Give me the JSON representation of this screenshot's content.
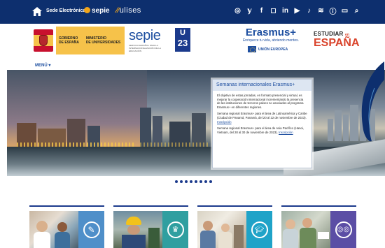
{
  "topbar": {
    "sede_label": "Sede Electrónica",
    "esepie_label": "sepie",
    "ulises_label": "ulises",
    "social_icons": [
      "podcast-icon",
      "twitter-icon",
      "facebook-icon",
      "instagram-icon",
      "linkedin-icon",
      "youtube-icon",
      "tiktok-icon",
      "spotify-icon",
      "info-icon",
      "chat-icon",
      "search-icon"
    ]
  },
  "logos": {
    "gobierno_line1": "GOBIERNO",
    "gobierno_line2": "DE ESPAÑA",
    "ministerio_line1": "MINISTERIO",
    "ministerio_line2": "DE UNIVERSIDADES",
    "sepie_word": "sepie",
    "sepie_sub": "SERVICIO ESPAÑOL PARA LA INTERNACIONALIZACIÓN DE LA EDUCACIÓN",
    "u23_top": "U",
    "u23_bottom": "23",
    "erasmus_word": "Erasmus+",
    "erasmus_tag": "Enriquece tu vida, abriendo mentes.",
    "ue_label": "UNIÓN EUROPEA",
    "estudiar_l1": "ESTUDIAR",
    "estudiar_l1_suffix": "en",
    "estudiar_l2": "ESPAÑA"
  },
  "menu_label": "MENÚ",
  "hero": {
    "panel_title": "Semanas internacionales Erasmus+",
    "paragraphs": [
      "El objetivo de estas jornadas, en formato presencial y virtual, es mejorar la cooperación internacional incrementando la presencia de las instituciones de terceros países no asociados al programa Erasmus+ en diferentes regiones.",
      "Semana regional Erasmus+ para el área de Latinoamérica y Caribe (Ciudad de Panamá, Panamá, del 20 al 22 de noviembre de 2023).",
      "Semana regional Erasmus+ para el área de Asia Pacífico (Hanoi, Vietnam, del 28 al 30 de noviembre de 2023)."
    ],
    "link_label": "Inscripción",
    "slide_count": 8
  },
  "cards": [
    {
      "icon": "pencil-icon",
      "color": "#4f8fc9"
    },
    {
      "icon": "chef-hat-icon",
      "color": "#2f9fa0"
    },
    {
      "icon": "graduation-cap-icon",
      "color": "#1fa3c8"
    },
    {
      "icon": "glasses-icon",
      "color": "#5b4ea5"
    }
  ],
  "colors": {
    "topbar": "#0d2f6e",
    "accent": "#1e4fa0",
    "orange": "#f2a51a"
  }
}
